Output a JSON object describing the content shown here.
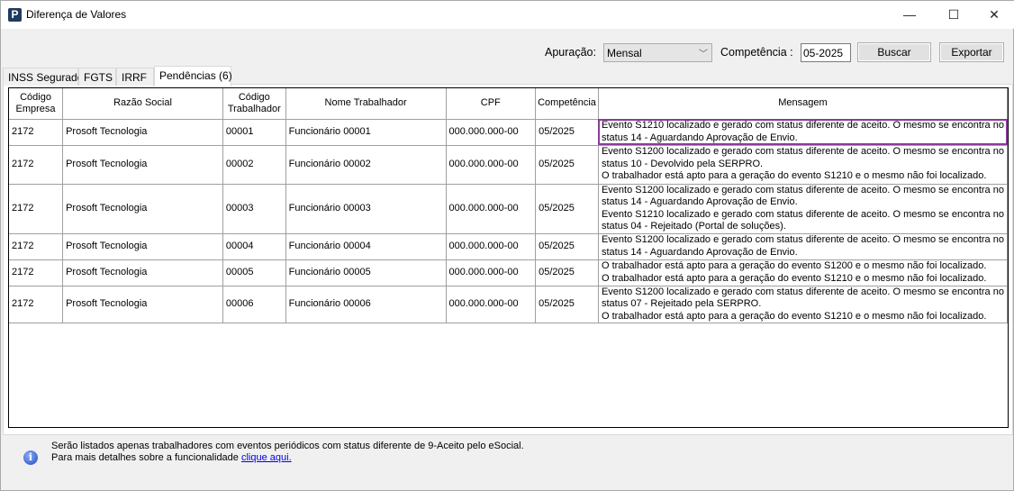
{
  "window": {
    "title": "Diferença de Valores",
    "icon": "P",
    "minimize": "—",
    "maximize": "☐",
    "close": "✕"
  },
  "toolbar": {
    "apuracao_label": "Apuração:",
    "apuracao_value": "Mensal",
    "competencia_label": "Competência :",
    "competencia_value": "05-2025",
    "buscar": "Buscar",
    "exportar": "Exportar"
  },
  "tabs": [
    {
      "label": "INSS Segurado"
    },
    {
      "label": "FGTS"
    },
    {
      "label": "IRRF"
    },
    {
      "label": "Pendências (6)"
    }
  ],
  "table": {
    "headers": [
      [
        "Código",
        "Empresa"
      ],
      [
        "Razão Social"
      ],
      [
        "Código",
        "Trabalhador"
      ],
      [
        "Nome Trabalhador"
      ],
      [
        "CPF"
      ],
      [
        "Competência"
      ],
      [
        "Mensagem"
      ]
    ],
    "rows": [
      {
        "empresa": "2172",
        "razao": "Prosoft Tecnologia",
        "codigo": "00001",
        "nome": "Funcionário 00001",
        "cpf": "000.000.000-00",
        "comp": "05/2025",
        "msg": [
          "Evento S1210 localizado e gerado com status diferente de aceito. O mesmo se encontra no",
          "status 14 - Aguardando Aprovação de Envio."
        ]
      },
      {
        "empresa": "2172",
        "razao": "Prosoft Tecnologia",
        "codigo": "00002",
        "nome": "Funcionário 00002",
        "cpf": "000.000.000-00",
        "comp": "05/2025",
        "msg": [
          "Evento S1200 localizado e gerado com status diferente de aceito. O mesmo se encontra no",
          "status 10 - Devolvido pela SERPRO.",
          "O trabalhador está apto para a geração do evento S1210 e o mesmo não foi localizado."
        ]
      },
      {
        "empresa": "2172",
        "razao": "Prosoft Tecnologia",
        "codigo": "00003",
        "nome": "Funcionário 00003",
        "cpf": "000.000.000-00",
        "comp": "05/2025",
        "msg": [
          "Evento S1200 localizado e gerado com status diferente de aceito. O mesmo se encontra no",
          "status 14 - Aguardando Aprovação de Envio.",
          "Evento S1210 localizado e gerado com status diferente de aceito. O mesmo se encontra no",
          "status 04 - Rejeitado (Portal de soluções)."
        ]
      },
      {
        "empresa": "2172",
        "razao": "Prosoft Tecnologia",
        "codigo": "00004",
        "nome": "Funcionário 00004",
        "cpf": "000.000.000-00",
        "comp": "05/2025",
        "msg": [
          "Evento S1200 localizado e gerado com status diferente de aceito. O mesmo se encontra no",
          "status 14 - Aguardando Aprovação de Envio."
        ]
      },
      {
        "empresa": "2172",
        "razao": "Prosoft Tecnologia",
        "codigo": "00005",
        "nome": "Funcionário 00005",
        "cpf": "000.000.000-00",
        "comp": "05/2025",
        "msg": [
          "O trabalhador está apto para a geração do evento S1200 e o mesmo não foi localizado.",
          "O trabalhador está apto para a geração do evento S1210 e o mesmo não foi localizado."
        ]
      },
      {
        "empresa": "2172",
        "razao": "Prosoft Tecnologia",
        "codigo": "00006",
        "nome": "Funcionário 00006",
        "cpf": "000.000.000-00",
        "comp": "05/2025",
        "msg": [
          "Evento S1200 localizado e gerado com status diferente de aceito. O mesmo se encontra no",
          "status 07 - Rejeitado pela SERPRO.",
          "O trabalhador está apto para a geração do evento S1210 e o mesmo não foi localizado."
        ]
      }
    ]
  },
  "footer": {
    "line1": "Serão listados apenas trabalhadores com eventos periódicos com status diferente de 9-Aceito pelo eSocial.",
    "line2": "Para mais detalhes sobre a funcionalidade ",
    "link": "clique aqui.",
    "icon": "i"
  },
  "colors": {
    "selection": "#8a3b9c",
    "link": "#0000ee"
  }
}
